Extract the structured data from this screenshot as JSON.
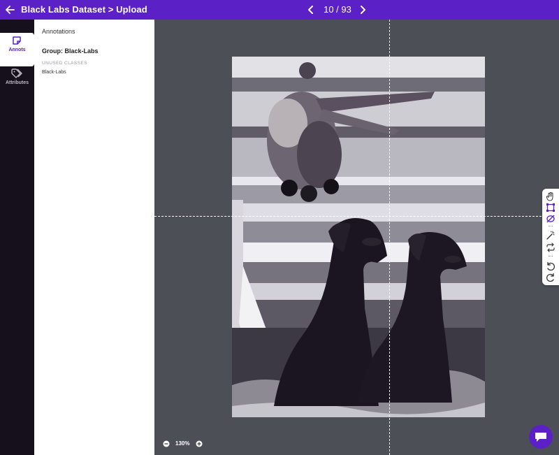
{
  "app": {
    "title": "Black Labs Dataset > Upload",
    "pager": {
      "current": "10 / 93"
    }
  },
  "colors": {
    "brand": "#5b20c6",
    "rail_bg": "#15101b",
    "canvas_bg": "#4c4f56"
  },
  "rail": {
    "items": [
      {
        "label": "Annots",
        "icon": "sticky-note-icon",
        "active": true
      },
      {
        "label": "Attributes",
        "icon": "tag-icon",
        "active": false
      }
    ]
  },
  "panel": {
    "header": "Annotations",
    "group": "Group: Black-Labs",
    "unused_label": "UNUSED CLASSES",
    "classes": [
      "Black-Labs"
    ]
  },
  "toolbar": {
    "tools": [
      "hand-icon",
      "bounding-box-icon",
      "polygon-icon",
      "magic-wand-icon",
      "repeat-icon",
      "undo-icon",
      "redo-icon"
    ]
  },
  "zoom": {
    "level": "130%"
  },
  "image": {
    "description": "Two black labrador dogs sitting below a hanging pheasant"
  }
}
